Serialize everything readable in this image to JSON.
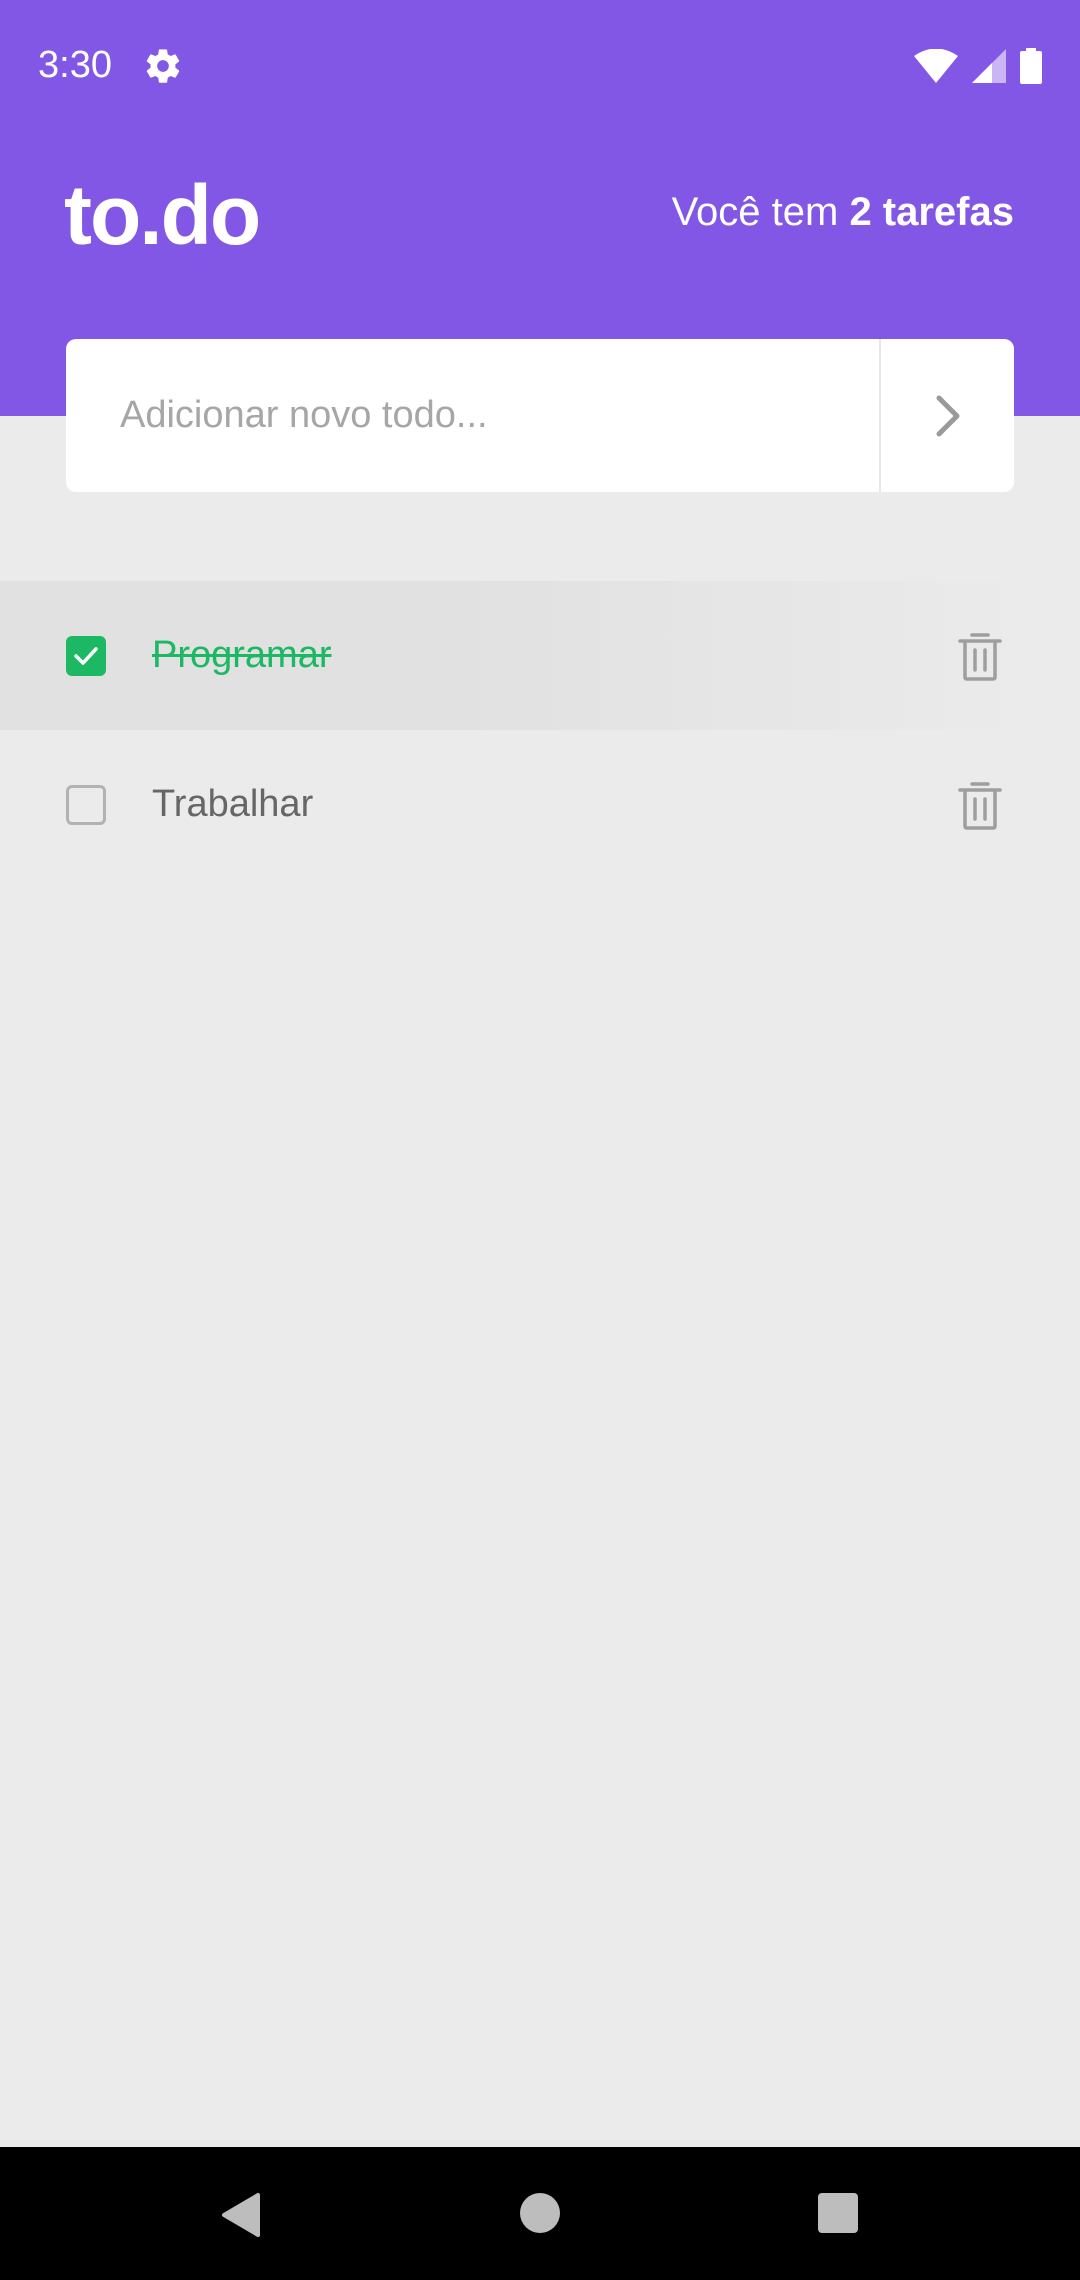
{
  "status_bar": {
    "time": "3:30",
    "icons": [
      "gear-icon",
      "wifi-icon",
      "signal-icon",
      "battery-icon"
    ]
  },
  "header": {
    "logo": "to.do",
    "counter_prefix": "Você tem ",
    "counter_value": "2 tarefas"
  },
  "new_todo": {
    "placeholder": "Adicionar novo todo...",
    "value": "",
    "submit_icon": "chevron-right-icon"
  },
  "tasks": [
    {
      "label": "Programar",
      "done": true
    },
    {
      "label": "Trabalhar",
      "done": false
    }
  ],
  "nav_bar": {
    "icons": [
      "back-icon",
      "home-icon",
      "recents-icon"
    ]
  },
  "colors": {
    "primary": "#8257e5",
    "done_green": "#1db863",
    "background": "#ebebeb"
  }
}
